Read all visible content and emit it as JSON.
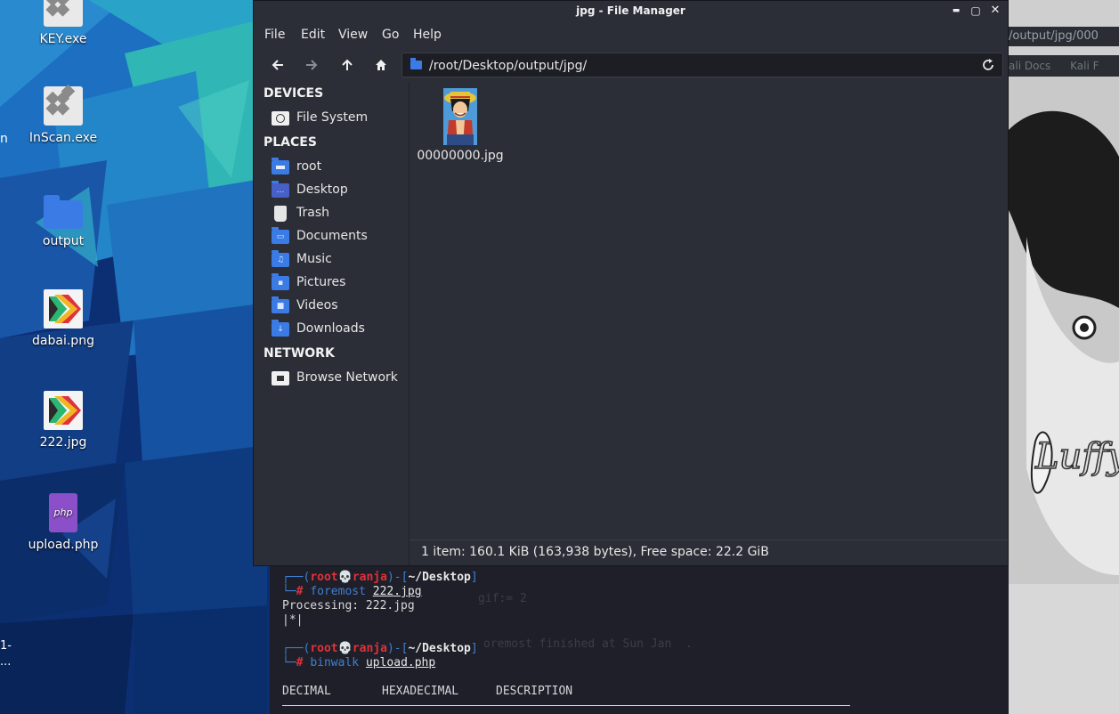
{
  "desktop": {
    "icons": [
      {
        "label": "KEY.exe",
        "icon": "exe-icon"
      },
      {
        "label": "InScan.exe",
        "icon": "exe-icon"
      },
      {
        "label": "output",
        "icon": "folder-icon"
      },
      {
        "label": "dabai.png",
        "icon": "image-icon"
      },
      {
        "label": "222.jpg",
        "icon": "image-icon"
      },
      {
        "label": "upload.php",
        "icon": "php-icon"
      }
    ],
    "edge_fragments": {
      "top": "n",
      "bottom1": "1-",
      "bottom2": "..."
    }
  },
  "window": {
    "title": "jpg - File Manager",
    "controls": {
      "minimize": "▬",
      "maximize": "▢",
      "close": "✕"
    }
  },
  "menu": {
    "file": "File",
    "edit": "Edit",
    "view": "View",
    "go": "Go",
    "help": "Help"
  },
  "location": {
    "path": "/root/Desktop/output/jpg/"
  },
  "sidebar": {
    "devices_heading": "DEVICES",
    "devices": [
      {
        "label": "File System",
        "icon": "drive-icon"
      }
    ],
    "places_heading": "PLACES",
    "places": [
      {
        "label": "root",
        "icon": "home-folder-icon"
      },
      {
        "label": "Desktop",
        "icon": "desktop-folder-icon"
      },
      {
        "label": "Trash",
        "icon": "trash-icon"
      },
      {
        "label": "Documents",
        "icon": "documents-folder-icon"
      },
      {
        "label": "Music",
        "icon": "music-folder-icon"
      },
      {
        "label": "Pictures",
        "icon": "pictures-folder-icon"
      },
      {
        "label": "Videos",
        "icon": "videos-folder-icon"
      },
      {
        "label": "Downloads",
        "icon": "downloads-folder-icon"
      }
    ],
    "network_heading": "NETWORK",
    "network": [
      {
        "label": "Browse Network",
        "icon": "network-icon"
      }
    ]
  },
  "files": [
    {
      "name": "00000000.jpg",
      "icon": "image-thumbnail"
    }
  ],
  "status": "1 item: 160.1 KiB (163,938 bytes), Free space: 22.2 GiB",
  "terminal": {
    "prompt1": {
      "user": "root",
      "host": "ranja",
      "dir": "~/Desktop"
    },
    "cmd1": "foremost",
    "cmd1_arg": "222.jpg",
    "out1": "Processing: 222.jpg",
    "out2": "|*|",
    "prompt2": {
      "user": "root",
      "host": "ranja",
      "dir": "~/Desktop"
    },
    "cmd2": "binwalk",
    "cmd2_arg": "upload.php",
    "headers": {
      "decimal": "DECIMAL",
      "hex": "HEXADECIMAL",
      "desc": "DESCRIPTION"
    },
    "ghost1": "gif:= 2",
    "ghost2": "oremost finished at Sun Jan  ."
  },
  "background_browser": {
    "address_fragment": "/output/jpg/000",
    "tab1": "ali Docs",
    "tab2": "Kali F"
  },
  "colors": {
    "accent": "#3b7be6",
    "window_bg": "#2b2e36",
    "terminal_bg": "#1e1f29",
    "prompt_red": "#e0323a",
    "prompt_blue": "#3f7fd1"
  }
}
